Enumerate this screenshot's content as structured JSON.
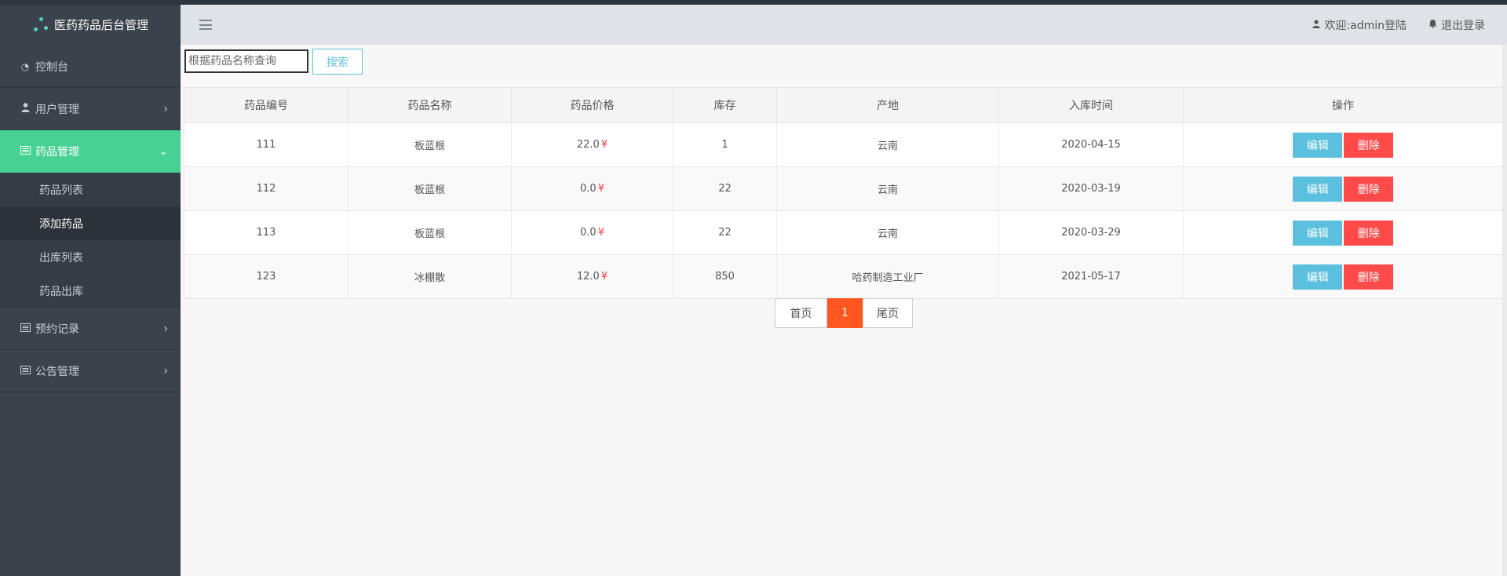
{
  "app": {
    "title": "医药药品后台管理"
  },
  "header": {
    "welcome": "欢迎:admin登陆",
    "logout": "退出登录"
  },
  "sidebar": {
    "items": [
      {
        "label": "控制台",
        "icon": "dashboard-icon",
        "expandable": false
      },
      {
        "label": "用户管理",
        "icon": "user-icon",
        "expandable": true
      },
      {
        "label": "药品管理",
        "icon": "list-icon",
        "expandable": true,
        "active": true,
        "children": [
          "药品列表",
          "添加药品",
          "出库列表",
          "药品出库"
        ],
        "current_child": "添加药品"
      },
      {
        "label": "预约记录",
        "icon": "list-icon",
        "expandable": true
      },
      {
        "label": "公告管理",
        "icon": "list-icon",
        "expandable": true
      }
    ]
  },
  "search": {
    "placeholder": "根据药品名称查询",
    "button_label": "搜索"
  },
  "table": {
    "columns": [
      "药品编号",
      "药品名称",
      "药品价格",
      "库存",
      "产地",
      "入库时间",
      "操作"
    ],
    "currency_symbol": "¥",
    "edit_label": "编辑",
    "delete_label": "删除",
    "rows": [
      {
        "id": "111",
        "name": "板蓝根",
        "price": "22.0",
        "stock": "1",
        "origin": "云南",
        "date": "2020-04-15"
      },
      {
        "id": "112",
        "name": "板蓝根",
        "price": "0.0",
        "stock": "22",
        "origin": "云南",
        "date": "2020-03-19"
      },
      {
        "id": "113",
        "name": "板蓝根",
        "price": "0.0",
        "stock": "22",
        "origin": "云南",
        "date": "2020-03-29"
      },
      {
        "id": "123",
        "name": "冰棚散",
        "price": "12.0",
        "stock": "850",
        "origin": "哈药制造工业厂",
        "date": "2021-05-17"
      }
    ]
  },
  "pagination": {
    "first": "首页",
    "current": "1",
    "last": "尾页"
  },
  "colors": {
    "sidebar_bg": "#3a424b",
    "active_nav": "#48d195",
    "edit_btn": "#5bc0de",
    "delete_btn": "#ff4a4a",
    "pager_current": "#ff5722",
    "price_symbol": "#ff3c3c"
  }
}
